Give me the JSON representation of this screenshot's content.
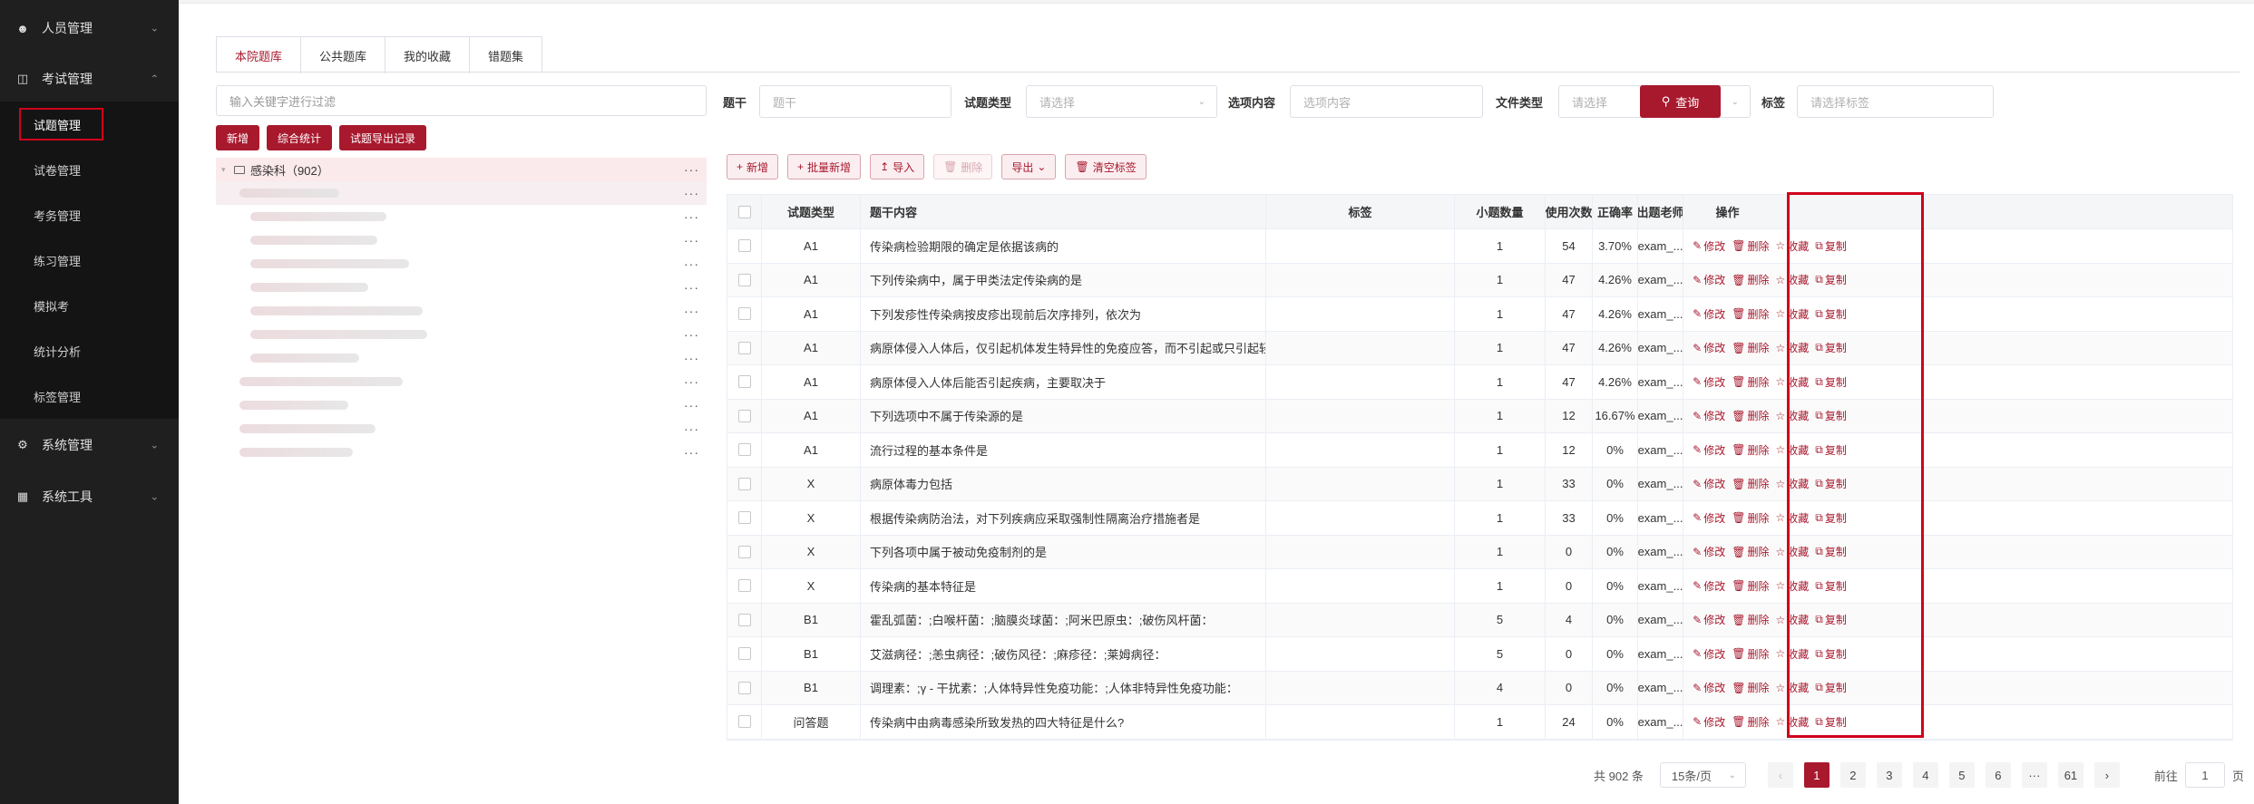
{
  "sidebar": {
    "groups": [
      {
        "label": "人员管理",
        "icon": "user-icon"
      },
      {
        "label": "考试管理",
        "icon": "layout-icon"
      },
      {
        "label": "系统管理",
        "icon": "gear-icon"
      },
      {
        "label": "系统工具",
        "icon": "toolbox-icon"
      }
    ],
    "exam_items": [
      "试题管理",
      "试卷管理",
      "考务管理",
      "练习管理",
      "模拟考",
      "统计分析",
      "标签管理"
    ]
  },
  "tabs": [
    "本院题库",
    "公共题库",
    "我的收藏",
    "错题集"
  ],
  "left": {
    "keyword_placeholder": "输入关键字进行过滤",
    "buttons": [
      "新增",
      "综合统计",
      "试题导出记录"
    ],
    "tree_root": "感染科（902）"
  },
  "search": {
    "stem_label": "题干",
    "stem_placeholder": "题干",
    "type_label": "试题类型",
    "type_placeholder": "请选择",
    "option_label": "选项内容",
    "option_placeholder": "选项内容",
    "file_label": "文件类型",
    "file_placeholder": "请选择",
    "tag_label": "标签",
    "tag_placeholder": "请选择标签",
    "query_label": "查询"
  },
  "toolbar": {
    "add": "新增",
    "batch_add": "批量新增",
    "import": "导入",
    "delete": "删除",
    "export": "导出",
    "clear_tags": "清空标签"
  },
  "table": {
    "headers": [
      "试题类型",
      "题干内容",
      "标签",
      "小题数量",
      "使用次数",
      "正确率",
      "出题老师",
      "操作"
    ],
    "op_labels": [
      "修改",
      "删除",
      "收藏",
      "复制"
    ],
    "rows": [
      {
        "type": "A1",
        "stem": "传染病检验期限的确定是依据该病的",
        "tag": "",
        "count": "1",
        "uses": "54",
        "rate": "3.70%",
        "teacher": "exam_..."
      },
      {
        "type": "A1",
        "stem": "下列传染病中，属于甲类法定传染病的是",
        "tag": "",
        "count": "1",
        "uses": "47",
        "rate": "4.26%",
        "teacher": "exam_..."
      },
      {
        "type": "A1",
        "stem": "下列发疹性传染病按皮疹出现前后次序排列，依次为",
        "tag": "",
        "count": "1",
        "uses": "47",
        "rate": "4.26%",
        "teacher": "exam_..."
      },
      {
        "type": "A1",
        "stem": "病原体侵入人体后，仅引起机体发生特异性的免疫应答，而不引起或只引起轻微的组织损伤，临床上不显出任何症",
        "tag": "",
        "count": "1",
        "uses": "47",
        "rate": "4.26%",
        "teacher": "exam_..."
      },
      {
        "type": "A1",
        "stem": "病原体侵入人体后能否引起疾病，主要取决于",
        "tag": "",
        "count": "1",
        "uses": "47",
        "rate": "4.26%",
        "teacher": "exam_..."
      },
      {
        "type": "A1",
        "stem": "下列选项中不属于传染源的是",
        "tag": "",
        "count": "1",
        "uses": "12",
        "rate": "16.67%",
        "teacher": "exam_..."
      },
      {
        "type": "A1",
        "stem": "流行过程的基本条件是",
        "tag": "",
        "count": "1",
        "uses": "12",
        "rate": "0%",
        "teacher": "exam_..."
      },
      {
        "type": "X",
        "stem": "病原体毒力包括",
        "tag": "",
        "count": "1",
        "uses": "33",
        "rate": "0%",
        "teacher": "exam_..."
      },
      {
        "type": "X",
        "stem": "根据传染病防治法，对下列疾病应采取强制性隔离治疗措施者是",
        "tag": "",
        "count": "1",
        "uses": "33",
        "rate": "0%",
        "teacher": "exam_..."
      },
      {
        "type": "X",
        "stem": "下列各项中属于被动免疫制剂的是",
        "tag": "",
        "count": "1",
        "uses": "0",
        "rate": "0%",
        "teacher": "exam_..."
      },
      {
        "type": "X",
        "stem": "传染病的基本特征是",
        "tag": "",
        "count": "1",
        "uses": "0",
        "rate": "0%",
        "teacher": "exam_..."
      },
      {
        "type": "B1",
        "stem": "霍乱弧菌：;白喉杆菌：;脑膜炎球菌：;阿米巴原虫：;破伤风杆菌：",
        "tag": "",
        "count": "5",
        "uses": "4",
        "rate": "0%",
        "teacher": "exam_..."
      },
      {
        "type": "B1",
        "stem": "艾滋病径：;恙虫病径：;破伤风径：;麻疹径：;莱姆病径：",
        "tag": "",
        "count": "5",
        "uses": "0",
        "rate": "0%",
        "teacher": "exam_..."
      },
      {
        "type": "B1",
        "stem": "调理素：;γ - 干扰素：;人体特异性免疫功能：;人体非特异性免疫功能：",
        "tag": "",
        "count": "4",
        "uses": "0",
        "rate": "0%",
        "teacher": "exam_..."
      },
      {
        "type": "问答题",
        "stem": "传染病中由病毒感染所致发热的四大特征是什么?",
        "tag": "",
        "count": "1",
        "uses": "24",
        "rate": "0%",
        "teacher": "exam_..."
      }
    ]
  },
  "pager": {
    "total": "共 902 条",
    "page_size": "15条/页",
    "pages": [
      "1",
      "2",
      "3",
      "4",
      "5",
      "6",
      "···",
      "61"
    ],
    "goto_label": "前往",
    "goto_value": "1",
    "goto_suffix": "页"
  },
  "colors": {
    "primary": "#a8192e",
    "highlight": "#d0021b",
    "sidebar": "#1f1f1f"
  }
}
